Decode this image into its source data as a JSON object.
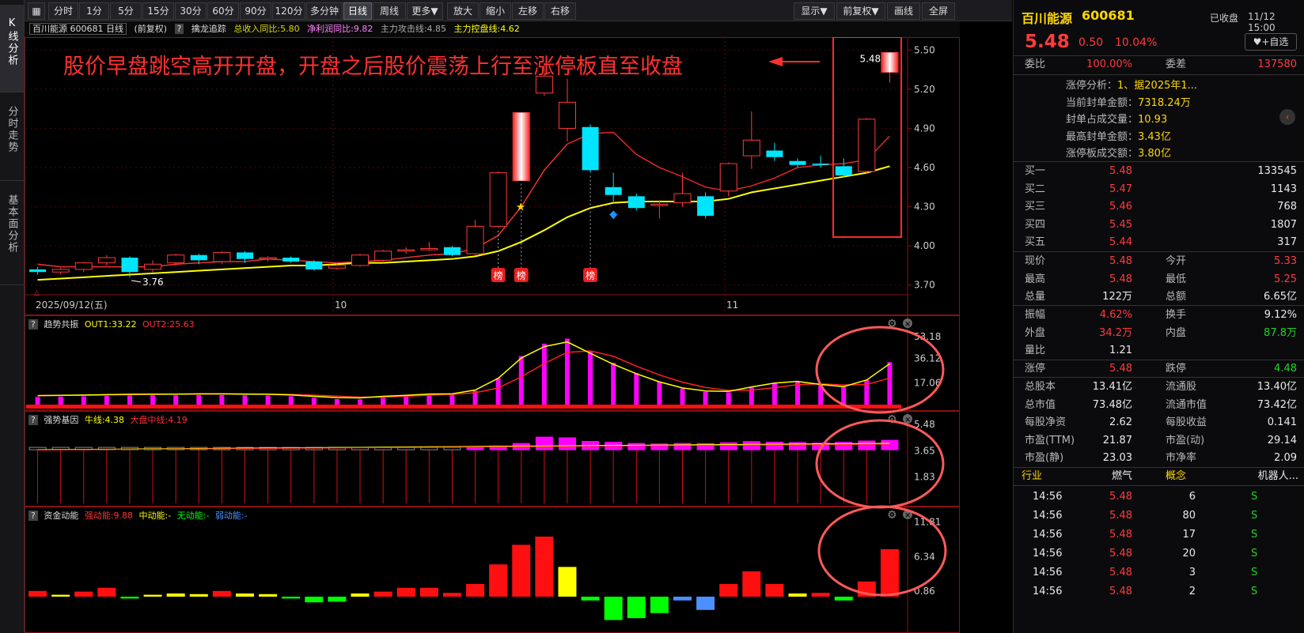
{
  "nav": {
    "kline": "K线分析",
    "intraday": "分时走势",
    "fundamental": "基本面分析"
  },
  "toolbar": {
    "periods": [
      "分时",
      "1分",
      "5分",
      "15分",
      "30分",
      "60分",
      "90分",
      "120分",
      "多分钟",
      "日线",
      "周线",
      "更多▼",
      "放大",
      "缩小",
      "左移",
      "右移"
    ],
    "active": "日线",
    "display": "显示▼",
    "adjust": "前复权▼",
    "draw": "画线",
    "fullscreen": "全屏"
  },
  "infobar": {
    "stock": "百川能源 600681 日线",
    "adj": "(前复权)",
    "q": "?",
    "indicator": "擒龙追踪",
    "rev": "总收入同比:5.80",
    "profit": "净利润同比:9.82",
    "attack": "主力攻击线:4.85",
    "control": "主力控盘线:4.62"
  },
  "annotation": "股价早盘跳空高开开盘，开盘之后股价震荡上行至涨停板直至收盘",
  "main": {
    "y_ticks": [
      "5.50",
      "5.20",
      "4.90",
      "4.60",
      "4.30",
      "4.00",
      "3.70"
    ],
    "x_labels": [
      "2025/09/12(五)",
      "10",
      "11"
    ],
    "high_label": "5.48",
    "low_label": "3.76",
    "bang": [
      "榜",
      "榜",
      "榜"
    ]
  },
  "sub1": {
    "q": "?",
    "name": "趋势共振",
    "out1": "OUT1:33.22",
    "out2": "OUT2:25.63",
    "ticks": [
      "53.18",
      "36.12",
      "17.06"
    ]
  },
  "sub2": {
    "q": "?",
    "name": "强势基因",
    "bull": "牛线:4.38",
    "market": "大盘中线:4.19",
    "ticks": [
      "5.48",
      "3.65",
      "1.83"
    ]
  },
  "sub3": {
    "q": "?",
    "name": "资金动能",
    "strong": "强动能:9.88",
    "mid": "中动能:-",
    "none": "无动能:-",
    "weak": "弱动能:-",
    "ticks": [
      "11.81",
      "6.34",
      "0.86"
    ]
  },
  "chart_data": [
    {
      "type": "candlestick",
      "title": "百川能源 600681 日线",
      "ylim": [
        3.65,
        5.55
      ],
      "y_ticks": [
        3.7,
        4.0,
        4.3,
        4.6,
        4.9,
        5.2,
        5.5
      ],
      "candles": [
        {
          "o": 3.82,
          "c": 3.8,
          "h": 3.84,
          "l": 3.78
        },
        {
          "o": 3.8,
          "c": 3.82,
          "h": 3.83,
          "l": 3.78
        },
        {
          "o": 3.82,
          "c": 3.87,
          "h": 3.88,
          "l": 3.8
        },
        {
          "o": 3.87,
          "c": 3.91,
          "h": 3.93,
          "l": 3.85
        },
        {
          "o": 3.91,
          "c": 3.8,
          "h": 3.92,
          "l": 3.76
        },
        {
          "o": 3.82,
          "c": 3.86,
          "h": 3.89,
          "l": 3.8
        },
        {
          "o": 3.87,
          "c": 3.93,
          "h": 3.94,
          "l": 3.85
        },
        {
          "o": 3.93,
          "c": 3.89,
          "h": 3.94,
          "l": 3.86
        },
        {
          "o": 3.88,
          "c": 3.95,
          "h": 3.96,
          "l": 3.86
        },
        {
          "o": 3.95,
          "c": 3.9,
          "h": 3.96,
          "l": 3.87
        },
        {
          "o": 3.9,
          "c": 3.91,
          "h": 3.92,
          "l": 3.88
        },
        {
          "o": 3.91,
          "c": 3.88,
          "h": 3.92,
          "l": 3.87
        },
        {
          "o": 3.88,
          "c": 3.82,
          "h": 3.89,
          "l": 3.81
        },
        {
          "o": 3.83,
          "c": 3.85,
          "h": 3.87,
          "l": 3.82
        },
        {
          "o": 3.85,
          "c": 3.93,
          "h": 3.94,
          "l": 3.84
        },
        {
          "o": 3.89,
          "c": 3.96,
          "h": 3.97,
          "l": 3.87
        },
        {
          "o": 3.96,
          "c": 3.97,
          "h": 3.99,
          "l": 3.94
        },
        {
          "o": 3.97,
          "c": 3.98,
          "h": 4.03,
          "l": 3.96
        },
        {
          "o": 3.99,
          "c": 3.93,
          "h": 4.0,
          "l": 3.92
        },
        {
          "o": 3.94,
          "c": 4.15,
          "h": 4.2,
          "l": 3.93
        },
        {
          "o": 4.15,
          "c": 4.56,
          "h": 4.57,
          "l": 4.14
        },
        {
          "o": 4.5,
          "c": 5.02,
          "h": 5.02,
          "l": 4.5
        },
        {
          "o": 5.17,
          "c": 5.3,
          "h": 5.4,
          "l": 5.15
        },
        {
          "o": 4.9,
          "c": 5.1,
          "h": 5.28,
          "l": 4.8
        },
        {
          "o": 4.91,
          "c": 4.58,
          "h": 4.93,
          "l": 4.56
        },
        {
          "o": 4.45,
          "c": 4.39,
          "h": 4.56,
          "l": 4.34
        },
        {
          "o": 4.38,
          "c": 4.29,
          "h": 4.4,
          "l": 4.27
        },
        {
          "o": 4.31,
          "c": 4.32,
          "h": 4.35,
          "l": 4.21
        },
        {
          "o": 4.33,
          "c": 4.4,
          "h": 4.56,
          "l": 4.3
        },
        {
          "o": 4.38,
          "c": 4.23,
          "h": 4.41,
          "l": 4.21
        },
        {
          "o": 4.42,
          "c": 4.63,
          "h": 4.64,
          "l": 4.38
        },
        {
          "o": 4.69,
          "c": 4.81,
          "h": 5.03,
          "l": 4.59
        },
        {
          "o": 4.73,
          "c": 4.68,
          "h": 4.79,
          "l": 4.65
        },
        {
          "o": 4.65,
          "c": 4.62,
          "h": 4.67,
          "l": 4.6
        },
        {
          "o": 4.63,
          "c": 4.62,
          "h": 4.69,
          "l": 4.6
        },
        {
          "o": 4.61,
          "c": 4.54,
          "h": 4.67,
          "l": 4.53
        },
        {
          "o": 4.57,
          "c": 4.97,
          "h": 4.98,
          "l": 4.55
        },
        {
          "o": 5.33,
          "c": 5.48,
          "h": 5.48,
          "l": 5.25
        }
      ],
      "ma_red": [
        3.86,
        3.84,
        3.84,
        3.84,
        3.84,
        3.84,
        3.86,
        3.87,
        3.88,
        3.88,
        3.9,
        3.89,
        3.88,
        3.87,
        3.88,
        3.89,
        3.91,
        3.93,
        3.94,
        3.98,
        4.08,
        4.3,
        4.58,
        4.78,
        4.86,
        4.87,
        4.7,
        4.6,
        4.53,
        4.45,
        4.42,
        4.46,
        4.52,
        4.6,
        4.62,
        4.63,
        4.66,
        4.84
      ],
      "ma_yellow": [
        3.74,
        3.75,
        3.76,
        3.77,
        3.78,
        3.79,
        3.8,
        3.81,
        3.82,
        3.83,
        3.84,
        3.85,
        3.85,
        3.86,
        3.87,
        3.87,
        3.88,
        3.89,
        3.9,
        3.92,
        3.96,
        4.03,
        4.12,
        4.22,
        4.29,
        4.33,
        4.34,
        4.34,
        4.34,
        4.34,
        4.36,
        4.41,
        4.44,
        4.47,
        4.5,
        4.53,
        4.56,
        4.61
      ],
      "annotations": [
        "榜",
        "榜",
        "榜"
      ]
    },
    {
      "type": "bar",
      "title": "趋势共振",
      "series": [
        {
          "name": "OUT1",
          "values": [
            6.0,
            6.3,
            6.5,
            6.9,
            7.2,
            7.3,
            7.3,
            7.5,
            7.5,
            7.3,
            7.2,
            6.6,
            5.4,
            4.3,
            4.1,
            5.4,
            6.3,
            7.4,
            7.5,
            10.8,
            20.8,
            38.0,
            47.7,
            51.7,
            42.0,
            32.7,
            24.6,
            17.7,
            12.6,
            10.0,
            9.6,
            13.4,
            16.7,
            18.1,
            15.5,
            13.7,
            19.3,
            33.2
          ]
        }
      ],
      "ylim": [
        0,
        60
      ],
      "y_ticks": [
        17.06,
        36.12,
        53.18
      ]
    },
    {
      "type": "bar",
      "title": "强势基因",
      "series": [
        {
          "name": "牛线",
          "values": [
            3.73,
            3.75,
            3.76,
            3.76,
            3.76,
            3.78,
            3.78,
            3.8,
            3.8,
            3.79,
            3.8,
            3.79,
            3.78,
            3.8,
            3.8,
            3.82,
            3.83,
            3.83,
            3.85,
            3.91,
            3.98,
            4.16,
            4.6,
            4.55,
            4.3,
            4.24,
            4.16,
            4.12,
            4.16,
            4.15,
            4.21,
            4.29,
            4.25,
            4.22,
            4.18,
            4.24,
            4.33,
            4.38
          ]
        }
      ],
      "ylim": [
        0,
        5.48
      ],
      "y_ticks": [
        1.83,
        3.65,
        5.48
      ]
    },
    {
      "type": "bar",
      "title": "资金动能",
      "series": [
        {
          "name": "强动能",
          "values": [
            0.9,
            0.3,
            0.8,
            1.4,
            -0.3,
            0.3,
            0.5,
            0.4,
            0.9,
            0.5,
            0.4,
            -0.3,
            -0.9,
            -0.8,
            0.5,
            0.8,
            1.4,
            1.4,
            0.6,
            2.0,
            5.1,
            8.2,
            9.5,
            4.7,
            -0.6,
            -3.7,
            -3.4,
            -2.6,
            -0.6,
            -2.1,
            2.0,
            4.0,
            2.0,
            0.5,
            0.6,
            -0.6,
            2.4,
            7.5
          ]
        }
      ],
      "ylim": [
        -4,
        12
      ],
      "y_ticks": [
        0.86,
        6.34,
        11.81
      ]
    }
  ],
  "quote": {
    "name": "百川能源",
    "code": "600681",
    "status": "已收盘",
    "time": "11/12 15:00",
    "price": "5.48",
    "change": "0.50",
    "pct": "10.04%",
    "watch_btn": "+自选",
    "weibi_label": "委比",
    "weibi": "100.00%",
    "weicha_label": "委差",
    "weicha": "137580"
  },
  "limitup": [
    {
      "label": "涨停分析：",
      "value": "1、据2025年1..."
    },
    {
      "label": "当前封单金额：",
      "value": "7318.24万"
    },
    {
      "label": "封单占成交量：",
      "value": "10.93"
    },
    {
      "label": "最高封单金额：",
      "value": "3.43亿"
    },
    {
      "label": "涨停板成交额：",
      "value": "3.80亿"
    }
  ],
  "orderbook": [
    {
      "label": "买一",
      "price": "5.48",
      "vol": "133545"
    },
    {
      "label": "买二",
      "price": "5.47",
      "vol": "1143"
    },
    {
      "label": "买三",
      "price": "5.46",
      "vol": "768"
    },
    {
      "label": "买四",
      "price": "5.45",
      "vol": "1807"
    },
    {
      "label": "买五",
      "price": "5.44",
      "vol": "317"
    }
  ],
  "stats1": [
    {
      "l1": "现价",
      "v1": "5.48",
      "c1": "red",
      "l2": "今开",
      "v2": "5.33",
      "c2": "red"
    },
    {
      "l1": "最高",
      "v1": "5.48",
      "c1": "red",
      "l2": "最低",
      "v2": "5.25",
      "c2": "red"
    },
    {
      "l1": "总量",
      "v1": "122万",
      "c1": "white",
      "l2": "总额",
      "v2": "6.65亿",
      "c2": "white"
    }
  ],
  "stats2": [
    {
      "l1": "振幅",
      "v1": "4.62%",
      "c1": "red",
      "l2": "换手",
      "v2": "9.12%",
      "c2": "white"
    },
    {
      "l1": "外盘",
      "v1": "34.2万",
      "c1": "red",
      "l2": "内盘",
      "v2": "87.8万",
      "c2": "green"
    },
    {
      "l1": "量比",
      "v1": "1.21",
      "c1": "white",
      "l2": "",
      "v2": "",
      "c2": "white"
    }
  ],
  "stats3": [
    {
      "l1": "涨停",
      "v1": "5.48",
      "c1": "red",
      "l2": "跌停",
      "v2": "4.48",
      "c2": "green"
    }
  ],
  "stats4": [
    {
      "l1": "总股本",
      "v1": "13.41亿",
      "c1": "white",
      "l2": "流通股",
      "v2": "13.40亿",
      "c2": "white"
    },
    {
      "l1": "总市值",
      "v1": "73.48亿",
      "c1": "white",
      "l2": "流通市值",
      "v2": "73.42亿",
      "c2": "white"
    },
    {
      "l1": "每股净资",
      "v1": "2.62",
      "c1": "white",
      "l2": "每股收益",
      "v2": "0.141",
      "c2": "white"
    },
    {
      "l1": "市盈(TTM)",
      "v1": "21.87",
      "c1": "white",
      "l2": "市盈(动)",
      "v2": "29.14",
      "c2": "white"
    },
    {
      "l1": "市盈(静)",
      "v1": "23.03",
      "c1": "white",
      "l2": "市净率",
      "v2": "2.09",
      "c2": "white"
    }
  ],
  "industry": {
    "label": "行业",
    "value": "燃气",
    "concept_label": "概念",
    "concept": "机器人..."
  },
  "ticks": [
    {
      "time": "14:56",
      "price": "5.48",
      "vol": "6",
      "side": "S"
    },
    {
      "time": "14:56",
      "price": "5.48",
      "vol": "80",
      "side": "S"
    },
    {
      "time": "14:56",
      "price": "5.48",
      "vol": "17",
      "side": "S"
    },
    {
      "time": "14:56",
      "price": "5.48",
      "vol": "20",
      "side": "S"
    },
    {
      "time": "14:56",
      "price": "5.48",
      "vol": "3",
      "side": "S"
    },
    {
      "time": "14:56",
      "price": "5.48",
      "vol": "2",
      "side": "S"
    }
  ],
  "colors": {
    "up": "#ff3b3b",
    "down": "#00e5ff",
    "ma_red": "#ff2a2a",
    "ma_yellow": "#ffff00",
    "magenta": "#ff00ff",
    "green": "#00ff00",
    "yellow": "#ffff00",
    "blue": "#4a90ff",
    "annotation": "#ff3030"
  }
}
